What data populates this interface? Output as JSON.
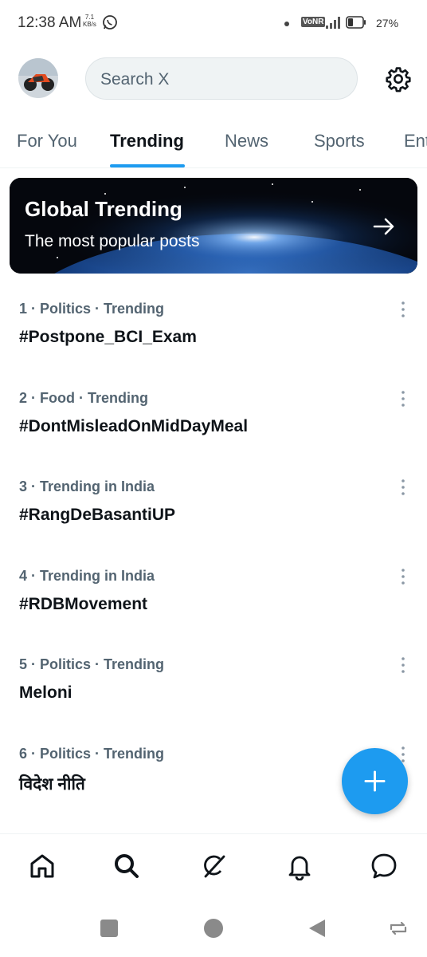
{
  "status_bar": {
    "time": "12:38 AM",
    "speed_value": "7.1",
    "speed_unit": "KB/s",
    "network_badge": "VoNR",
    "battery": "27%"
  },
  "header": {
    "search_placeholder": "Search X",
    "avatar_icon": "profile-avatar",
    "settings_icon": "gear-icon"
  },
  "tabs": [
    {
      "label": "For You",
      "active": false
    },
    {
      "label": "Trending",
      "active": true
    },
    {
      "label": "News",
      "active": false
    },
    {
      "label": "Sports",
      "active": false
    },
    {
      "label": "Ent",
      "active": false
    }
  ],
  "banner": {
    "title": "Global Trending",
    "subtitle": "The most popular posts"
  },
  "trends": [
    {
      "meta": "1 · Politics · Trending",
      "name": "#Postpone_BCI_Exam"
    },
    {
      "meta": "2 · Food · Trending",
      "name": "#DontMisleadOnMidDayMeal"
    },
    {
      "meta": "3 · Trending in India",
      "name": "#RangDeBasantiUP"
    },
    {
      "meta": "4 · Trending in India",
      "name": "#RDBMovement"
    },
    {
      "meta": "5 · Politics · Trending",
      "name": "Meloni"
    },
    {
      "meta": "6 · Politics · Trending",
      "name": "विदेश नीति"
    }
  ],
  "colors": {
    "accent": "#1d9bf0",
    "text_primary": "#0f1419",
    "text_secondary": "#536471"
  },
  "bottom_nav": [
    "home-icon",
    "search-icon",
    "grok-icon",
    "notifications-icon",
    "messages-icon"
  ],
  "system_nav": [
    "recents-icon",
    "home-circle-icon",
    "back-icon",
    "rotate-icon"
  ]
}
